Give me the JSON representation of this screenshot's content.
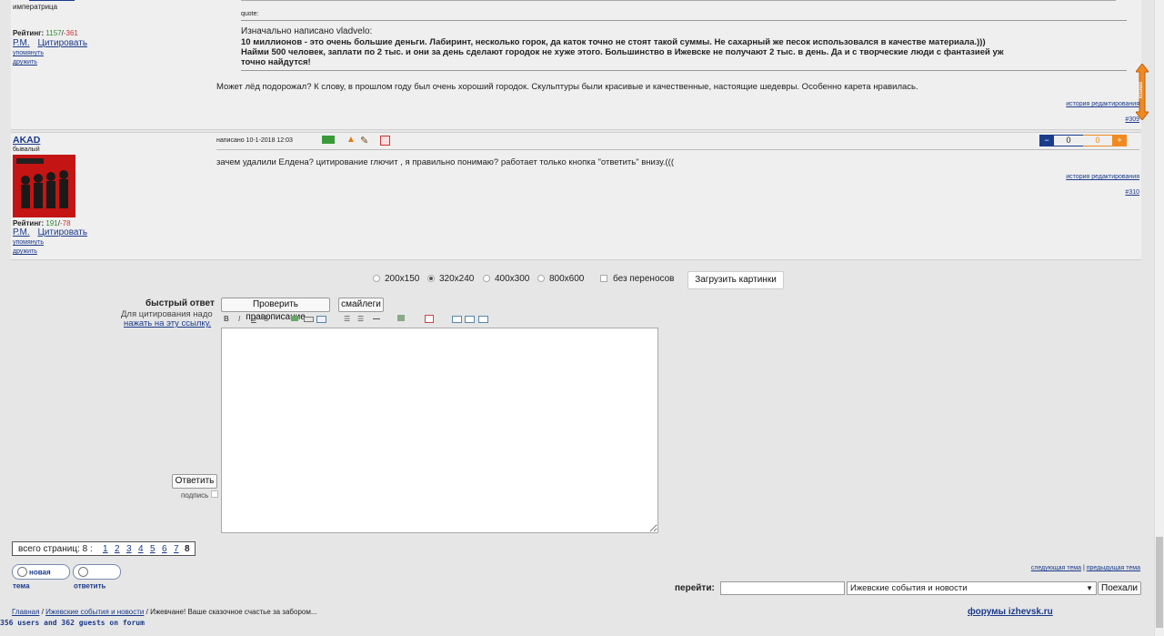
{
  "post1": {
    "user_title": "императрица",
    "rating_label": "Рейтинг:",
    "rating_pos": "1157",
    "rating_sep": "/",
    "rating_neg": "-361",
    "pm": "Р.М.",
    "quote_link": "Цитировать",
    "mention": "упомянуть",
    "friend": "дружить",
    "quote_header": "quote:",
    "quote_author": "Изначально написано vladvelo:",
    "quote_line1": "10 миллионов - это очень большие деньги. Лабиринт, несколько горок, да каток точно не стоят такой суммы. Не сахарный же песок использовался в качестве материала.)))",
    "quote_line2": "Найми 500 человек, заплати по 2 тыс. и они за день сделают городок не хуже этого. Большинство в Ижевске не получают 2 тыс. в день. Да и с творческие люди с фантазией уж",
    "quote_line3": "точно найдутся!",
    "text": "Может лёд подорожал? К слову, в прошлом году был очень хороший городок. Скульптуры были красивые и качественные, настоящие шедевры. Особенно карета нравилась.",
    "edit_history": "история редактирования",
    "number": "#309"
  },
  "post2": {
    "username": "AKAD",
    "user_title": "бывалый",
    "rating_label": "Рейтинг:",
    "rating_pos": "191",
    "rating_sep": "/",
    "rating_neg": "-78",
    "pm": "Р.М.",
    "quote_link": "Цитировать",
    "mention": "упомянуть",
    "friend": "дружить",
    "posted": "написано 10-1-2018 12:03",
    "text": "зачем удалили Елдена? цитирование глючит , я правильно понимаю? работает только кнопка \"ответить\" внизу.(((",
    "edit_history": "история редактирования",
    "number": "#310",
    "vote_minus": "−",
    "vote_left": "0",
    "vote_right": "0",
    "vote_plus": "+"
  },
  "image_sizes": [
    "200x150",
    "320x240",
    "400x300",
    "800x600"
  ],
  "no_wrap": "без переносов",
  "upload_btn": "Загрузить картинки",
  "quick_reply": {
    "title": "быстрый ответ",
    "hint1": "Для цитирования надо",
    "hint2": "нажать на эту ссылку.",
    "spellcheck": "Проверить правописание",
    "smileys": "смайлеги",
    "reply_btn": "Ответить",
    "signature": "подпись",
    "textarea_value": ""
  },
  "toolbar": {
    "bold": "B",
    "italic": "I",
    "underline": "U",
    "strike": "S"
  },
  "pagination": {
    "label": "всего страниц: 8 :",
    "pages": [
      "1",
      "2",
      "3",
      "4",
      "5",
      "6",
      "7"
    ],
    "current": "8"
  },
  "new_topic": "новая тема",
  "reply": "ответить",
  "next_topic": "следующая тема",
  "sep": "|",
  "prev_topic": "предыдущая тема",
  "goto_label": "перейти:",
  "goto_select": "Ижевские события и новости",
  "goto_btn": "Поехали",
  "breadcrumb": {
    "home": "Главная",
    "s1": "/",
    "section": "Ижевские события и новости",
    "s2": "/",
    "topic": "Ижевчане! Ваше сказочное счастье за забором..."
  },
  "online": "356 users and 362 guests on forum",
  "forums_link": "форумы izhevsk.ru",
  "up_button": "вверх",
  "colors": {
    "accent": "#1a3a8c",
    "pos": "#2a8a2a",
    "neg": "#d03030",
    "orange": "#f08a20"
  }
}
